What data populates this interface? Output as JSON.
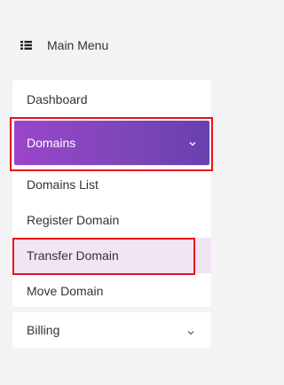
{
  "header": {
    "title": "Main Menu",
    "icon": "list-icon"
  },
  "menu": {
    "dashboard_label": "Dashboard",
    "domains": {
      "label": "Domains",
      "expanded": true,
      "icon": "chevron-down-icon",
      "items": [
        {
          "label": "Domains List"
        },
        {
          "label": "Register Domain"
        },
        {
          "label": "Transfer Domain",
          "highlighted": true
        },
        {
          "label": "Move Domain"
        }
      ]
    },
    "billing": {
      "label": "Billing",
      "icon": "chevron-down-icon"
    }
  },
  "colors": {
    "accent_start": "#9a45cc",
    "accent_end": "#6a3fae",
    "selected_bg": "#f1e5f3",
    "annotation": "#e8121a"
  }
}
